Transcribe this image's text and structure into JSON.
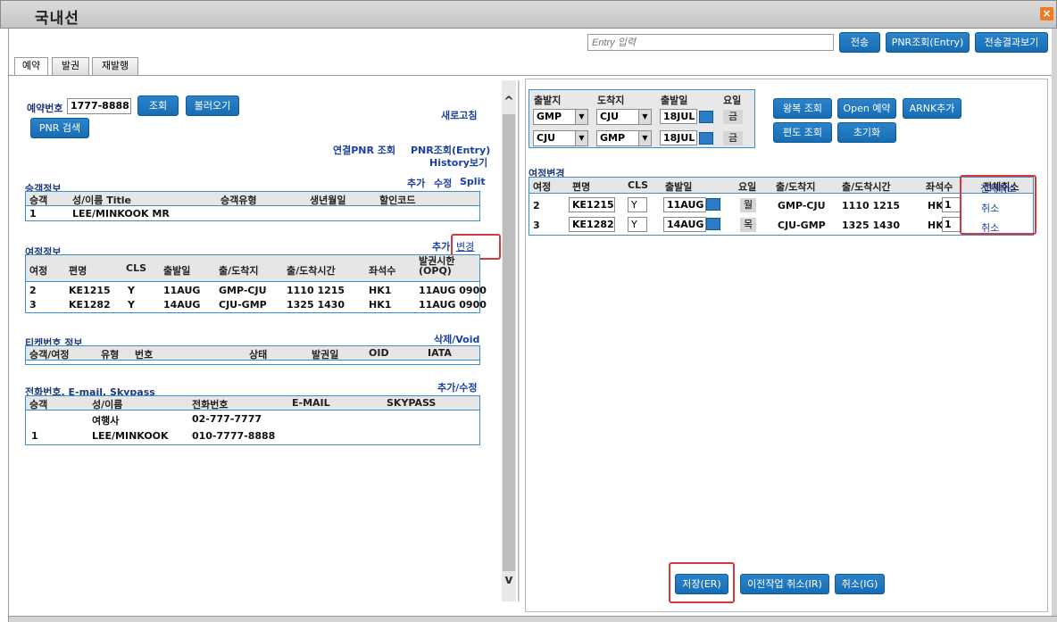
{
  "window": {
    "title": "국내선",
    "close_icon": "×"
  },
  "topbar": {
    "entry_placeholder": "Entry 입력",
    "send_label": "전송",
    "pnr_entry_label": "PNR조회(Entry)",
    "send_result_label": "전송결과보기"
  },
  "tabs": [
    "예약",
    "발권",
    "재발행"
  ],
  "booking": {
    "label": "예약번호",
    "number": "1777-8888",
    "search_label": "조회",
    "load_label": "불러오기",
    "pnr_search_label": "PNR 검색",
    "refresh_label": "새로고침",
    "linked_pnr_label": "연결PNR 조회",
    "pnr_entry_label": "PNR조회(Entry)",
    "history_label": "History보기"
  },
  "passenger": {
    "title": "승객정보",
    "actions": [
      "추가",
      "수정",
      "Split"
    ],
    "headers": [
      "승객",
      "성/이름 Title",
      "승객유형",
      "생년월일",
      "할인코드"
    ],
    "rows": [
      [
        "1",
        "LEE/MINKOOK MR",
        "",
        "",
        ""
      ]
    ]
  },
  "itinerary": {
    "title": "여정정보",
    "add_label": "추가",
    "change_label": "변경",
    "headers": [
      "여정",
      "편명",
      "CLS",
      "출발일",
      "출/도착지",
      "출/도착시간",
      "좌석수",
      "발권시한\n(OPQ)"
    ],
    "rows": [
      [
        "2",
        "KE1215",
        "Y",
        "11AUG",
        "GMP-CJU",
        "1110 1215",
        "HK1",
        "11AUG 0900"
      ],
      [
        "3",
        "KE1282",
        "Y",
        "14AUG",
        "CJU-GMP",
        "1325 1430",
        "HK1",
        "11AUG 0900"
      ]
    ]
  },
  "ticket": {
    "title": "티켓번호 정보",
    "action_label": "삭제/Void",
    "headers": [
      "승객/여정",
      "유형",
      "번호",
      "상태",
      "발권일",
      "OID",
      "IATA"
    ]
  },
  "contact": {
    "title": "전화번호, E-mail, Skypass",
    "action_label": "추가/수정",
    "headers": [
      "승객",
      "성/이름",
      "전화번호",
      "E-MAIL",
      "SKYPASS"
    ],
    "rows": [
      [
        "",
        "여행사",
        "02-777-7777",
        "",
        ""
      ],
      [
        "1",
        "LEE/MINKOOK",
        "010-7777-8888",
        "",
        ""
      ]
    ]
  },
  "search": {
    "headers": [
      "출발지",
      "도착지",
      "출발일",
      "요일"
    ],
    "rows": [
      {
        "from": "GMP",
        "to": "CJU",
        "date": "18JUL",
        "day": "금"
      },
      {
        "from": "CJU",
        "to": "GMP",
        "date": "18JUL",
        "day": "금"
      }
    ],
    "buttons": {
      "roundtrip": "왕복 조회",
      "open": "Open 예약",
      "arnk": "ARNK추가",
      "oneway": "편도 조회",
      "reset": "초기화"
    }
  },
  "change": {
    "title": "여정변경",
    "headers": [
      "여정",
      "편명",
      "CLS",
      "출발일",
      "요일",
      "출/도착지",
      "출/도착시간",
      "좌석수",
      "전체취소"
    ],
    "rows": [
      {
        "seg": "2",
        "flight": "KE1215",
        "cls": "Y",
        "date": "11AUG",
        "day": "월",
        "route": "GMP-CJU",
        "time": "1110 1215",
        "status": "HK",
        "seats": "1",
        "cancel": "취소"
      },
      {
        "seg": "3",
        "flight": "KE1282",
        "cls": "Y",
        "date": "14AUG",
        "day": "목",
        "route": "CJU-GMP",
        "time": "1325 1430",
        "status": "HK",
        "seats": "1",
        "cancel": "취소"
      }
    ]
  },
  "bottom": {
    "save_label": "저장(ER)",
    "undo_label": "이전작업 취소(IR)",
    "cancel_label": "취소(IG)"
  },
  "scroll": {
    "up": "^",
    "down": "v"
  },
  "colors": {
    "button": "#176db4",
    "highlight": "#d43a3a",
    "title_text": "#1f3a7a",
    "grid_border": "#3a8fc8"
  }
}
